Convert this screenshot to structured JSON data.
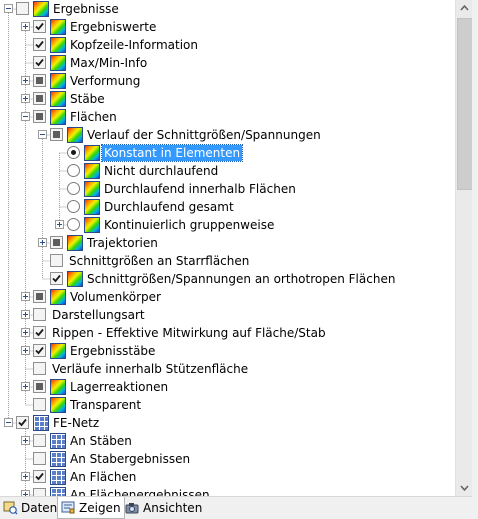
{
  "tree": [
    {
      "id": "ergebnisse",
      "label": "Ergebnisse",
      "level": 0,
      "expander": "minus",
      "control": "checkbox",
      "state": "unchecked",
      "icon": "rainbow"
    },
    {
      "id": "ergebniswerte",
      "label": "Ergebniswerte",
      "level": 1,
      "expander": "plus",
      "control": "checkbox",
      "state": "checked",
      "icon": "rainbow"
    },
    {
      "id": "kopfzeile",
      "label": "Kopfzeile-Information",
      "level": 1,
      "expander": "none",
      "control": "checkbox",
      "state": "checked",
      "icon": "rainbow"
    },
    {
      "id": "maxmin",
      "label": "Max/Min-Info",
      "level": 1,
      "expander": "none",
      "control": "checkbox",
      "state": "checked",
      "icon": "rainbow"
    },
    {
      "id": "verformung",
      "label": "Verformung",
      "level": 1,
      "expander": "plus",
      "control": "checkbox",
      "state": "partial",
      "icon": "rainbow"
    },
    {
      "id": "staebe",
      "label": "Stäbe",
      "level": 1,
      "expander": "plus",
      "control": "checkbox",
      "state": "partial",
      "icon": "rainbow"
    },
    {
      "id": "flaechen",
      "label": "Flächen",
      "level": 1,
      "expander": "minus",
      "control": "checkbox",
      "state": "partial",
      "icon": "rainbow"
    },
    {
      "id": "verlauf",
      "label": "Verlauf der Schnittgrößen/Spannungen",
      "level": 2,
      "expander": "minus",
      "control": "checkbox",
      "state": "partial",
      "icon": "rainbow"
    },
    {
      "id": "konstant",
      "label": "Konstant in Elementen",
      "level": 3,
      "expander": "none",
      "control": "radio",
      "state": "on",
      "icon": "rainbow",
      "selected": true
    },
    {
      "id": "nicht-durchlaufend",
      "label": "Nicht durchlaufend",
      "level": 3,
      "expander": "none",
      "control": "radio",
      "state": "off",
      "icon": "rainbow"
    },
    {
      "id": "durchl-innerhalb",
      "label": "Durchlaufend innerhalb Flächen",
      "level": 3,
      "expander": "none",
      "control": "radio",
      "state": "off",
      "icon": "rainbow"
    },
    {
      "id": "durchl-gesamt",
      "label": "Durchlaufend gesamt",
      "level": 3,
      "expander": "none",
      "control": "radio",
      "state": "off",
      "icon": "rainbow"
    },
    {
      "id": "kontinuierlich",
      "label": "Kontinuierlich gruppenweise",
      "level": 3,
      "expander": "plus",
      "control": "radio",
      "state": "off",
      "icon": "rainbow"
    },
    {
      "id": "trajektorien",
      "label": "Trajektorien",
      "level": 2,
      "expander": "plus",
      "control": "checkbox",
      "state": "partial",
      "icon": "rainbow"
    },
    {
      "id": "starrflaechen",
      "label": "Schnittgrößen an Starrflächen",
      "level": 2,
      "expander": "none",
      "control": "checkbox",
      "state": "unchecked",
      "icon": "none"
    },
    {
      "id": "orthotrop",
      "label": "Schnittgrößen/Spannungen an orthotropen Flächen",
      "level": 2,
      "expander": "none",
      "control": "checkbox",
      "state": "checked",
      "icon": "rainbow"
    },
    {
      "id": "volumen",
      "label": "Volumenkörper",
      "level": 1,
      "expander": "plus",
      "control": "checkbox",
      "state": "partial",
      "icon": "rainbow"
    },
    {
      "id": "darstellungsart",
      "label": "Darstellungsart",
      "level": 1,
      "expander": "plus",
      "control": "checkbox",
      "state": "unchecked",
      "icon": "none"
    },
    {
      "id": "rippen",
      "label": "Rippen - Effektive Mitwirkung auf Fläche/Stab",
      "level": 1,
      "expander": "plus",
      "control": "checkbox",
      "state": "checked",
      "icon": "none"
    },
    {
      "id": "ergebnisstaebe",
      "label": "Ergebnisstäbe",
      "level": 1,
      "expander": "plus",
      "control": "checkbox",
      "state": "checked",
      "icon": "rainbow"
    },
    {
      "id": "verlaeufe-stuetz",
      "label": "Verläufe innerhalb Stützenfläche",
      "level": 1,
      "expander": "none",
      "control": "checkbox",
      "state": "unchecked",
      "icon": "none"
    },
    {
      "id": "lagerreaktionen",
      "label": "Lagerreaktionen",
      "level": 1,
      "expander": "plus",
      "control": "checkbox",
      "state": "partial",
      "icon": "rainbow"
    },
    {
      "id": "transparent",
      "label": "Transparent",
      "level": 1,
      "expander": "none",
      "control": "checkbox",
      "state": "unchecked",
      "icon": "rainbow"
    },
    {
      "id": "fe-netz",
      "label": "FE-Netz",
      "level": 0,
      "expander": "minus",
      "control": "checkbox",
      "state": "checked",
      "icon": "grid"
    },
    {
      "id": "an-staeben",
      "label": "An Stäben",
      "level": 1,
      "expander": "plus",
      "control": "checkbox",
      "state": "unchecked",
      "icon": "grid"
    },
    {
      "id": "an-stabergebnissen",
      "label": "An Stabergebnissen",
      "level": 1,
      "expander": "none",
      "control": "checkbox",
      "state": "unchecked",
      "icon": "grid"
    },
    {
      "id": "an-flaechen",
      "label": "An Flächen",
      "level": 1,
      "expander": "plus",
      "control": "checkbox",
      "state": "checked",
      "icon": "grid"
    },
    {
      "id": "an-flaechenergebnissen",
      "label": "An Flächenergebnissen",
      "level": 1,
      "expander": "plus",
      "control": "checkbox",
      "state": "unchecked",
      "icon": "grid"
    }
  ],
  "tabs": [
    {
      "id": "daten",
      "label": "Daten",
      "active": false,
      "icon": "database-icon"
    },
    {
      "id": "zeigen",
      "label": "Zeigen",
      "active": true,
      "icon": "display-icon"
    },
    {
      "id": "ansichten",
      "label": "Ansichten",
      "active": false,
      "icon": "camera-icon"
    }
  ],
  "colors": {
    "selection": "#3399ff",
    "icon_border": "#2a4a8c"
  }
}
